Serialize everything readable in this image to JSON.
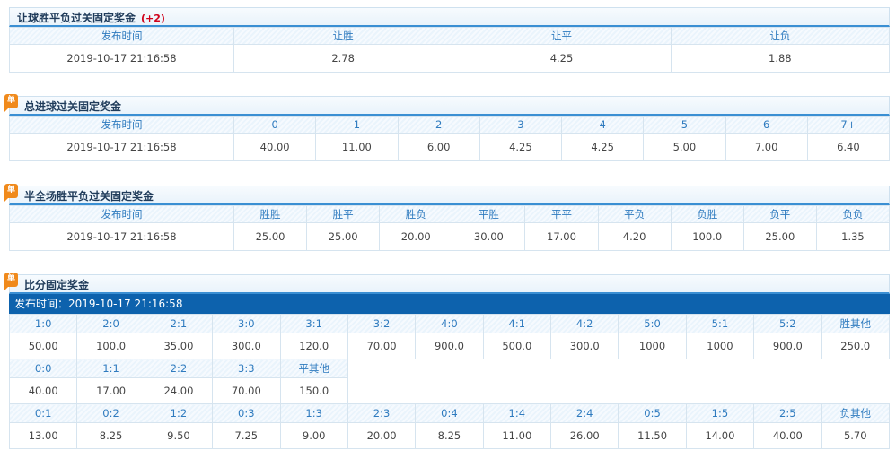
{
  "s1": {
    "title": "让球胜平负过关固定奖金",
    "handicap": "(+2)",
    "headers": [
      "发布时间",
      "让胜",
      "让平",
      "让负"
    ],
    "values": [
      "2019-10-17 21:16:58",
      "2.78",
      "4.25",
      "1.88"
    ]
  },
  "s2": {
    "badge": "单",
    "title": "总进球过关固定奖金",
    "headers": [
      "发布时间",
      "0",
      "1",
      "2",
      "3",
      "4",
      "5",
      "6",
      "7+"
    ],
    "values": [
      "2019-10-17 21:16:58",
      "40.00",
      "11.00",
      "6.00",
      "4.25",
      "4.25",
      "5.00",
      "7.00",
      "6.40"
    ]
  },
  "s3": {
    "badge": "单",
    "title": "半全场胜平负过关固定奖金",
    "headers": [
      "发布时间",
      "胜胜",
      "胜平",
      "胜负",
      "平胜",
      "平平",
      "平负",
      "负胜",
      "负平",
      "负负"
    ],
    "values": [
      "2019-10-17 21:16:58",
      "25.00",
      "25.00",
      "20.00",
      "30.00",
      "17.00",
      "4.20",
      "100.0",
      "25.00",
      "1.35"
    ]
  },
  "s4": {
    "badge": "单",
    "title": "比分固定奖金",
    "publish_time": "发布时间：2019-10-17 21:16:58",
    "win": {
      "headers": [
        "1:0",
        "2:0",
        "2:1",
        "3:0",
        "3:1",
        "3:2",
        "4:0",
        "4:1",
        "4:2",
        "5:0",
        "5:1",
        "5:2",
        "胜其他"
      ],
      "values": [
        "50.00",
        "100.0",
        "35.00",
        "300.0",
        "120.0",
        "70.00",
        "900.0",
        "500.0",
        "300.0",
        "1000",
        "1000",
        "900.0",
        "250.0"
      ]
    },
    "draw": {
      "headers": [
        "0:0",
        "1:1",
        "2:2",
        "3:3",
        "平其他"
      ],
      "values": [
        "40.00",
        "17.00",
        "24.00",
        "70.00",
        "150.0"
      ]
    },
    "lose": {
      "headers": [
        "0:1",
        "0:2",
        "1:2",
        "0:3",
        "1:3",
        "2:3",
        "0:4",
        "1:4",
        "2:4",
        "0:5",
        "1:5",
        "2:5",
        "负其他"
      ],
      "values": [
        "13.00",
        "8.25",
        "9.50",
        "7.25",
        "9.00",
        "20.00",
        "8.25",
        "11.00",
        "26.00",
        "11.50",
        "14.00",
        "40.00",
        "5.70"
      ]
    }
  }
}
